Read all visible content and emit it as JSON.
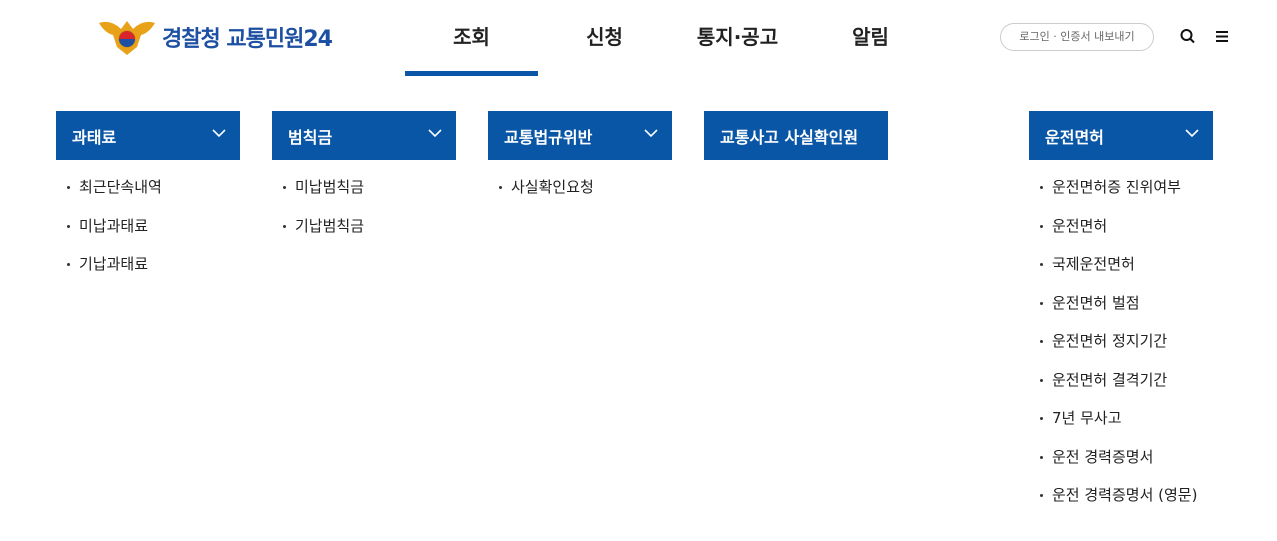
{
  "brand": {
    "name": "경찰청 교통민원24"
  },
  "nav": {
    "items": [
      {
        "label": "조회",
        "active": true
      },
      {
        "label": "신청",
        "active": false
      },
      {
        "label": "통지·공고",
        "active": false
      },
      {
        "label": "알림",
        "active": false
      }
    ]
  },
  "utility": {
    "login_label": "로그인 · 인증서 내보내기"
  },
  "colors": {
    "accent": "#0956a6",
    "brand_text": "#1d4fa3"
  },
  "menu": {
    "columns": [
      {
        "title": "과태료",
        "items": [
          "최근단속내역",
          "미납과태료",
          "기납과태료"
        ]
      },
      {
        "title": "범칙금",
        "items": [
          "미납범칙금",
          "기납범칙금"
        ]
      },
      {
        "title": "교통법규위반",
        "items": [
          "사실확인요청"
        ]
      },
      {
        "title": "교통사고 사실확인원",
        "items": []
      },
      {
        "title": "운전면허",
        "items": [
          "운전면허증 진위여부",
          "운전면허",
          "국제운전면허",
          "운전면허 벌점",
          "운전면허 정지기간",
          "운전면허 결격기간",
          "7년 무사고",
          "운전 경력증명서",
          "운전 경력증명서 (영문)"
        ]
      }
    ]
  }
}
